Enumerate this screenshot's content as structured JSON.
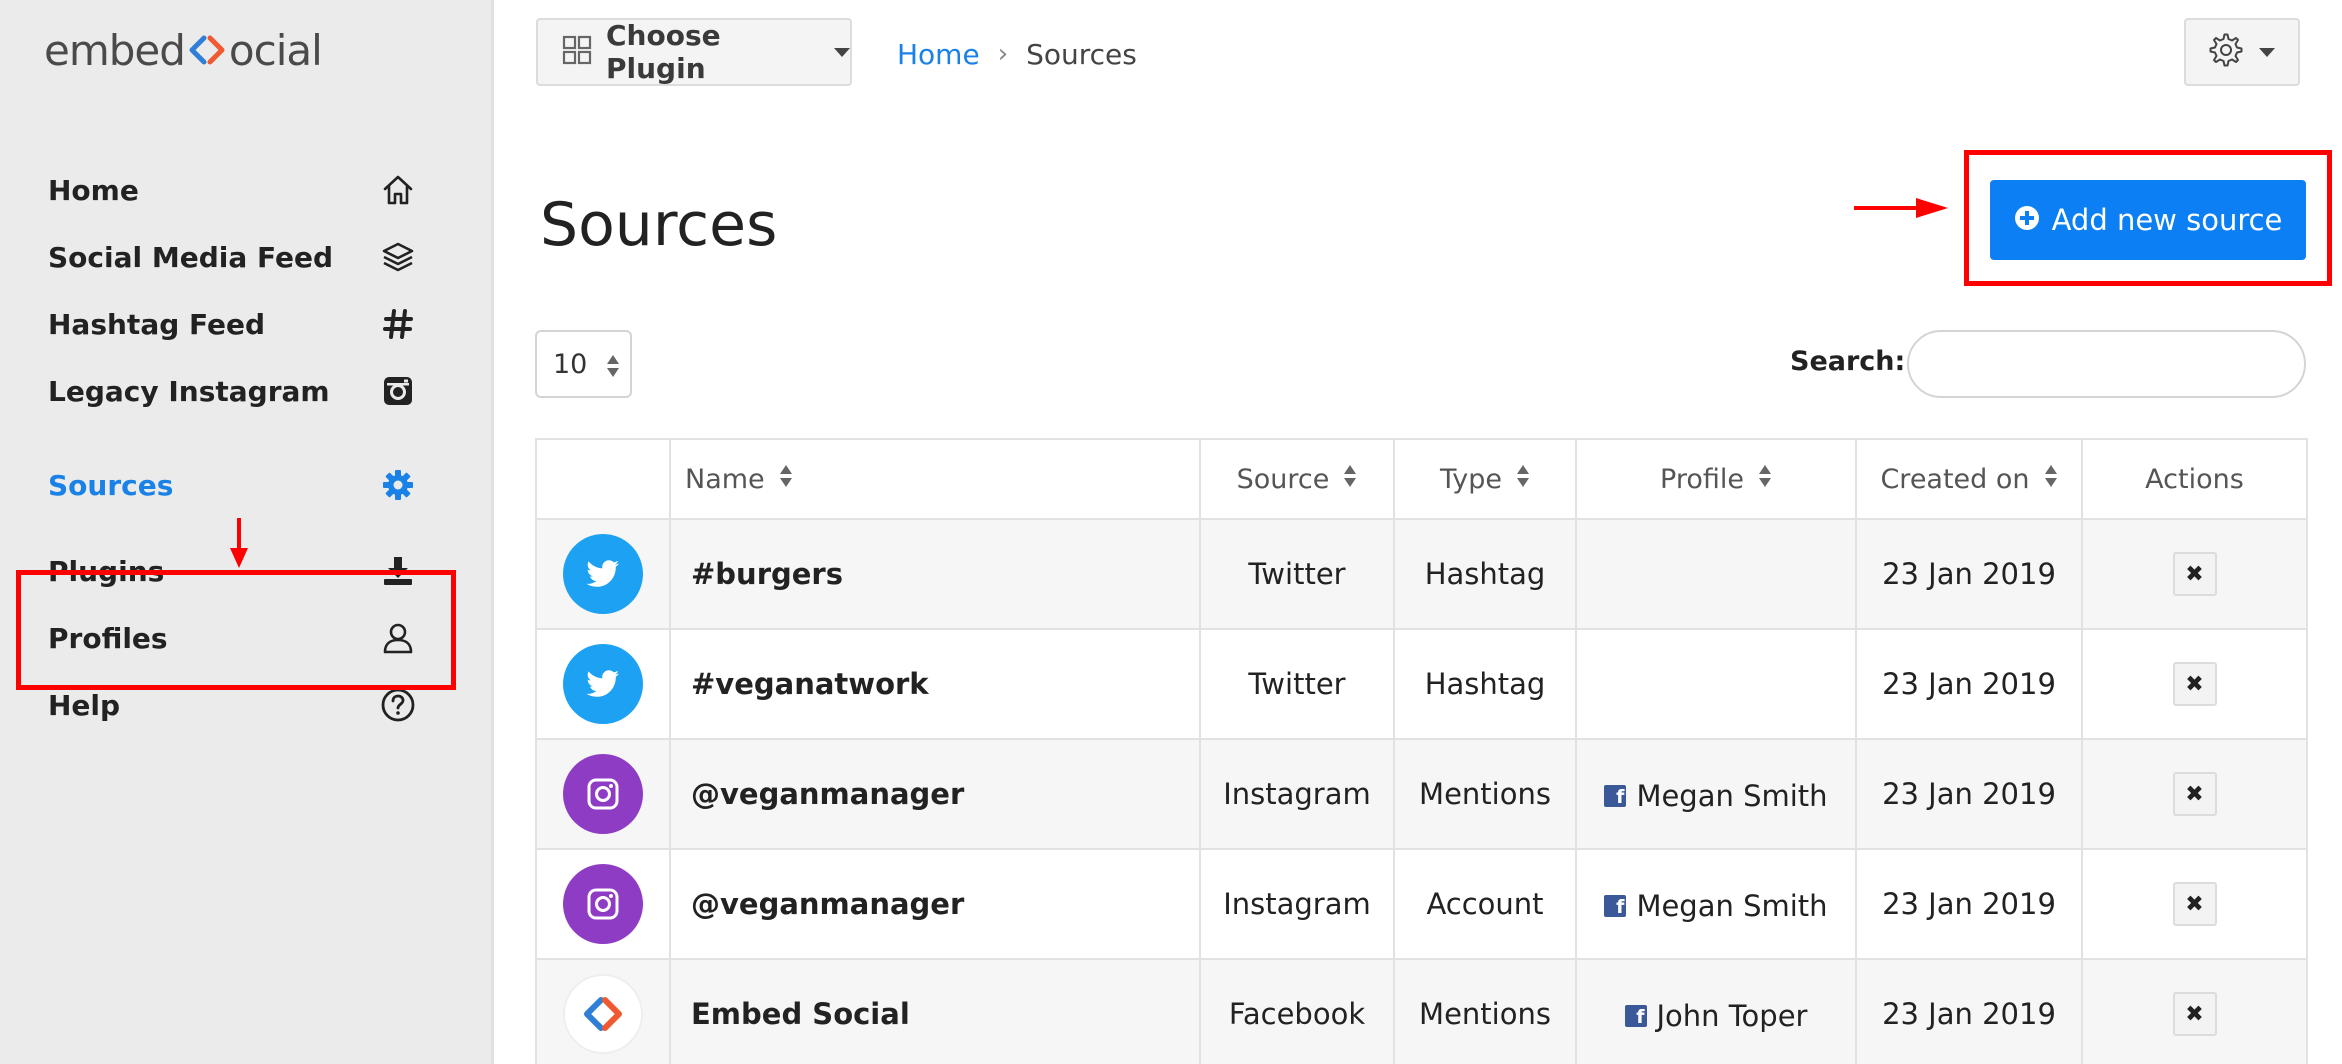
{
  "logo": {
    "left": "embed",
    "right": "ocial"
  },
  "sidebar": {
    "items": [
      {
        "label": "Home",
        "icon": "home-icon"
      },
      {
        "label": "Social Media Feed",
        "icon": "layers-icon"
      },
      {
        "label": "Hashtag Feed",
        "icon": "hashtag-icon"
      },
      {
        "label": "Legacy Instagram",
        "icon": "instagram-icon"
      },
      {
        "label": "Sources",
        "icon": "gear-icon",
        "active": true
      },
      {
        "label": "Plugins",
        "icon": "download-icon"
      },
      {
        "label": "Profiles",
        "icon": "user-icon"
      },
      {
        "label": "Help",
        "icon": "help-circle-icon"
      }
    ]
  },
  "topbar": {
    "choose_plugin": "Choose Plugin",
    "breadcrumb": {
      "home": "Home",
      "separator": "›",
      "current": "Sources"
    }
  },
  "page": {
    "title": "Sources",
    "add_button": "Add new source",
    "page_length": "10",
    "search_label": "Search:",
    "search_value": ""
  },
  "table": {
    "headers": [
      "",
      "Name",
      "Source",
      "Type",
      "Profile",
      "Created on",
      "Actions"
    ],
    "rows": [
      {
        "avatar": "twitter-icon",
        "name": "#burgers",
        "source": "Twitter",
        "type": "Hashtag",
        "profile": "",
        "created": "23 Jan 2019",
        "action": "✖"
      },
      {
        "avatar": "twitter-icon",
        "name": "#veganatwork",
        "source": "Twitter",
        "type": "Hashtag",
        "profile": "",
        "created": "23 Jan 2019",
        "action": "✖"
      },
      {
        "avatar": "instagram-icon",
        "name": "@veganmanager",
        "source": "Instagram",
        "type": "Mentions",
        "profile": "Megan Smith",
        "created": "23 Jan 2019",
        "action": "✖"
      },
      {
        "avatar": "instagram-icon",
        "name": "@veganmanager",
        "source": "Instagram",
        "type": "Account",
        "profile": "Megan Smith",
        "created": "23 Jan 2019",
        "action": "✖"
      },
      {
        "avatar": "embedsocial-logo-icon",
        "name": "Embed Social",
        "source": "Facebook",
        "type": "Mentions",
        "profile": "John Toper",
        "created": "23 Jan 2019",
        "action": "✖"
      }
    ]
  },
  "colors": {
    "accent": "#1a82e6",
    "button": "#0b7ff3",
    "highlight": "#ff0000",
    "twitter": "#1da1f2",
    "instagram": "#8f3cc4",
    "facebook": "#3b5998"
  }
}
